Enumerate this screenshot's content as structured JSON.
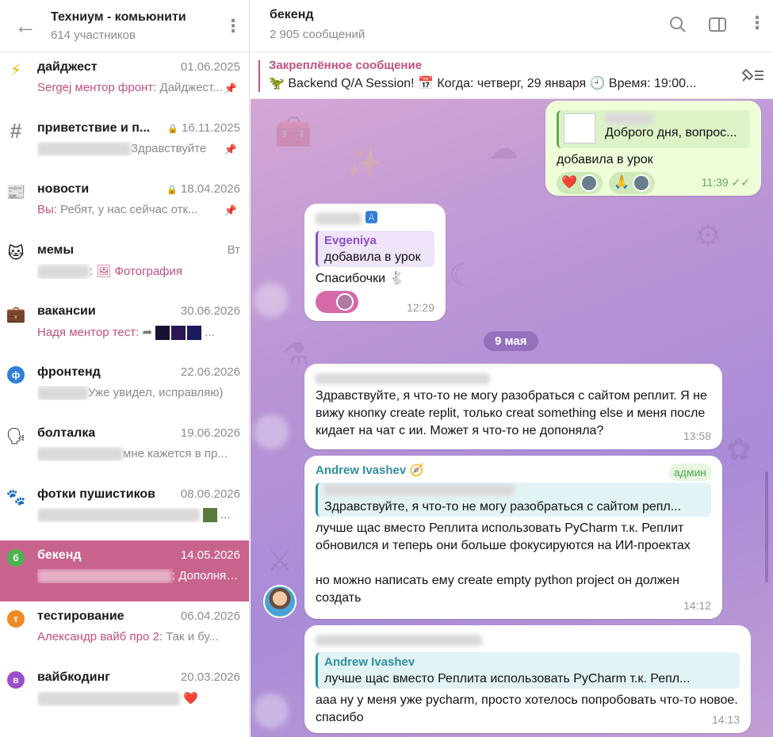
{
  "group": {
    "title": "Техниум - комьюнити",
    "members": "614 участников"
  },
  "topics": [
    {
      "name": "дайджест",
      "date": "01.06.2025",
      "sender": "Sergej ментор фронт:",
      "text": " Дайджест...",
      "icon": "lightning-icon",
      "pinned": true
    },
    {
      "name": "приветствие и п...",
      "date": "16.11.2025",
      "sender": "",
      "text": "Здравствуйте",
      "icon": "hashtag-icon",
      "pinned": true,
      "locked": true
    },
    {
      "name": "новости",
      "date": "18.04.2026",
      "sender": "Вы:",
      "text": " Ребят, у нас сейчас отк...",
      "icon": "newspaper-icon",
      "pinned": true,
      "locked": true
    },
    {
      "name": "мемы",
      "date": "Вт",
      "sender": "",
      "text": "Фотография",
      "icon": "cat-icon"
    },
    {
      "name": "вакансии",
      "date": "30.06.2026",
      "sender": "Надя ментор тест:",
      "text": " ...",
      "icon": "briefcase-icon"
    },
    {
      "name": "фронтенд",
      "date": "22.06.2026",
      "sender": "",
      "text": "Уже увидел, исправляю)",
      "icon": "frontend-badge-icon"
    },
    {
      "name": "болталка",
      "date": "19.06.2026",
      "sender": "",
      "text": "мне кажется в пр...",
      "icon": "speaking-head-icon"
    },
    {
      "name": "фотки пушистиков",
      "date": "08.06.2026",
      "sender": "",
      "text": "...",
      "icon": "paw-icon"
    },
    {
      "name": "бекенд",
      "date": "14.05.2026",
      "sender": "",
      "text": ": Дополняй...",
      "icon": "backend-badge-icon",
      "active": true
    },
    {
      "name": "тестирование",
      "date": "06.04.2026",
      "sender": "Александр вайб про 2:",
      "text": " Так и бу...",
      "icon": "testing-badge-icon"
    },
    {
      "name": "вайбкодинг",
      "date": "20.03.2026",
      "sender": "",
      "text": "❤️",
      "icon": "vibecoding-badge-icon"
    }
  ],
  "topic_letters": {
    "frontend": "ф",
    "backend": "б",
    "testing": "т",
    "vibecoding": "в"
  },
  "chat": {
    "title": "бекенд",
    "subtitle": "2 905 сообщений"
  },
  "pinned": {
    "title": "Закреплённое сообщение",
    "text": "Backend Q/A Session! 📅 Когда: четверг, 29 января 🕘 Время: 19:00..."
  },
  "messages": {
    "m1": {
      "reply_text": "Доброго дня, вопрос...",
      "text": "добавила в урок",
      "time": "11:39"
    },
    "m2": {
      "reply_name": "Evgeniya",
      "reply_text": "добавила в урок",
      "text": "Спасибочки 🐇",
      "time": "12:29"
    },
    "date_divider": "9 мая",
    "m3": {
      "text": "Здравствуйте, я что-то не могу разобраться с сайтом реплит. Я не вижу кнопку create replit, только creat something else и меня после кидает на чат с ии. Может я что-то не допоняла?",
      "time": "13:58"
    },
    "m4": {
      "name": "Andrew Ivashev",
      "tag": "админ",
      "reply_text": "Здравствуйте, я что-то не могу разобраться с сайтом репл...",
      "text1": "лучше щас вместо Реплита использовать PyCharm т.к. Реплит обновился и теперь они больше фокусируются на ИИ-проектах",
      "text2": "но можно написать ему create empty python project он должен создать",
      "time": "14:12"
    },
    "m5": {
      "reply_name": "Andrew Ivashev",
      "reply_text": "лучше щас вместо Реплита использовать PyCharm т.к. Репл...",
      "text": "ааа ну у меня уже pycharm, просто хотелось попробовать что-то новое. спасибо",
      "time": "14:13"
    }
  },
  "colors": {
    "accent": "#c2507f",
    "active_topic": "#c8638e",
    "outgoing_bubble": "#eefed9",
    "admin_green": "#4fa74f"
  }
}
